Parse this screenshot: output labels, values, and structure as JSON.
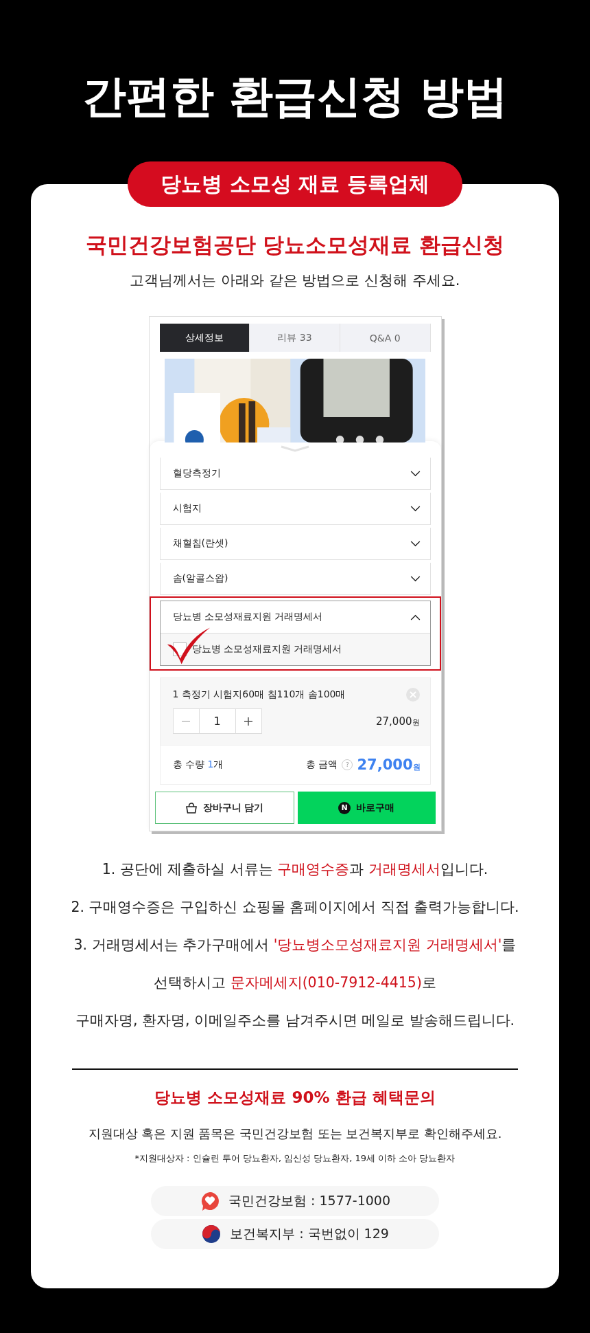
{
  "title": "간편한 환급신청 방법",
  "badge": "당뇨병 소모성 재료 등록업체",
  "heading": "국민건강보험공단 당뇨소모성재료 환급신청",
  "subtitle": "고객님께서는 아래와 같은 방법으로 신청해 주세요.",
  "product_screenshot": {
    "tabs": [
      {
        "label": "상세정보",
        "selected": true
      },
      {
        "label": "리뷰  33",
        "selected": false
      },
      {
        "label": "Q&A  0",
        "selected": false
      }
    ],
    "accordion": [
      {
        "label": "혈당측정기",
        "expanded": false,
        "highlighted": false
      },
      {
        "label": "시험지",
        "expanded": false,
        "highlighted": false
      },
      {
        "label": "채혈침(란셋)",
        "expanded": false,
        "highlighted": false
      },
      {
        "label": "솜(알콜스왑)",
        "expanded": false,
        "highlighted": false
      },
      {
        "label": "당뇨병 소모성재료지원 거래명세서",
        "expanded": true,
        "highlighted": true,
        "options": [
          {
            "label": "당뇨병 소모성재료지원 거래명세서",
            "checked": true
          }
        ]
      }
    ],
    "selected_item": {
      "name": "1 측정기 시험지60매 침110개 솜100매",
      "quantity": "1",
      "price": "27,000",
      "price_unit": "원"
    },
    "total": {
      "quantity_label": "총 수량",
      "quantity_value": "1",
      "quantity_unit": "개",
      "amount_label": "총 금액",
      "help_mark": "?",
      "amount": "27,000",
      "amount_unit": "원"
    },
    "buttons": [
      {
        "kind": "cart",
        "label": "장바구니 담기"
      },
      {
        "kind": "buy",
        "label": "바로구매",
        "logo_letter": "N"
      }
    ]
  },
  "instructions": [
    [
      {
        "text": "1. 공단에 제출하실 서류는 ",
        "highlight": false
      },
      {
        "text": "구매영수증",
        "highlight": true
      },
      {
        "text": "과 ",
        "highlight": false
      },
      {
        "text": "거래명세서",
        "highlight": true
      },
      {
        "text": "입니다.",
        "highlight": false
      }
    ],
    [
      {
        "text": "2. 구매영수증은 구입하신 쇼핑몰 홈페이지에서 직접 출력가능합니다.",
        "highlight": false
      }
    ],
    [
      {
        "text": "3. 거래명세서는 추가구매에서 ",
        "highlight": false
      },
      {
        "text": "'당뇨병소모성재료지원 거래명세서'",
        "highlight": true
      },
      {
        "text": "를",
        "highlight": false
      }
    ],
    [
      {
        "text": "선택하시고 ",
        "highlight": false
      },
      {
        "text": "문자메세지(010-7912-4415)",
        "highlight": true
      },
      {
        "text": "로",
        "highlight": false
      }
    ],
    [
      {
        "text": "구매자명, 환자명, 이메일주소를 남겨주시면 메일로 발송해드립니다.",
        "highlight": false
      }
    ]
  ],
  "inquiry": {
    "heading": "당뇨병 소모성재료 90% 환급 혜택문의",
    "note": "지원대상 혹은 지원 품목은 국민건강보험 또는 보건복지부로 확인해주세요.",
    "footnote": "*지원대상자 : 인슐린 투어 당뇨환자, 임신성 당뇨환자, 19세 이하 소아 당뇨환자",
    "contacts": [
      {
        "kind": "heart",
        "text": "국민건강보험 : 1577-1000"
      },
      {
        "kind": "taegeuk",
        "text": "보건복지부 : 국번없이 129"
      }
    ]
  }
}
